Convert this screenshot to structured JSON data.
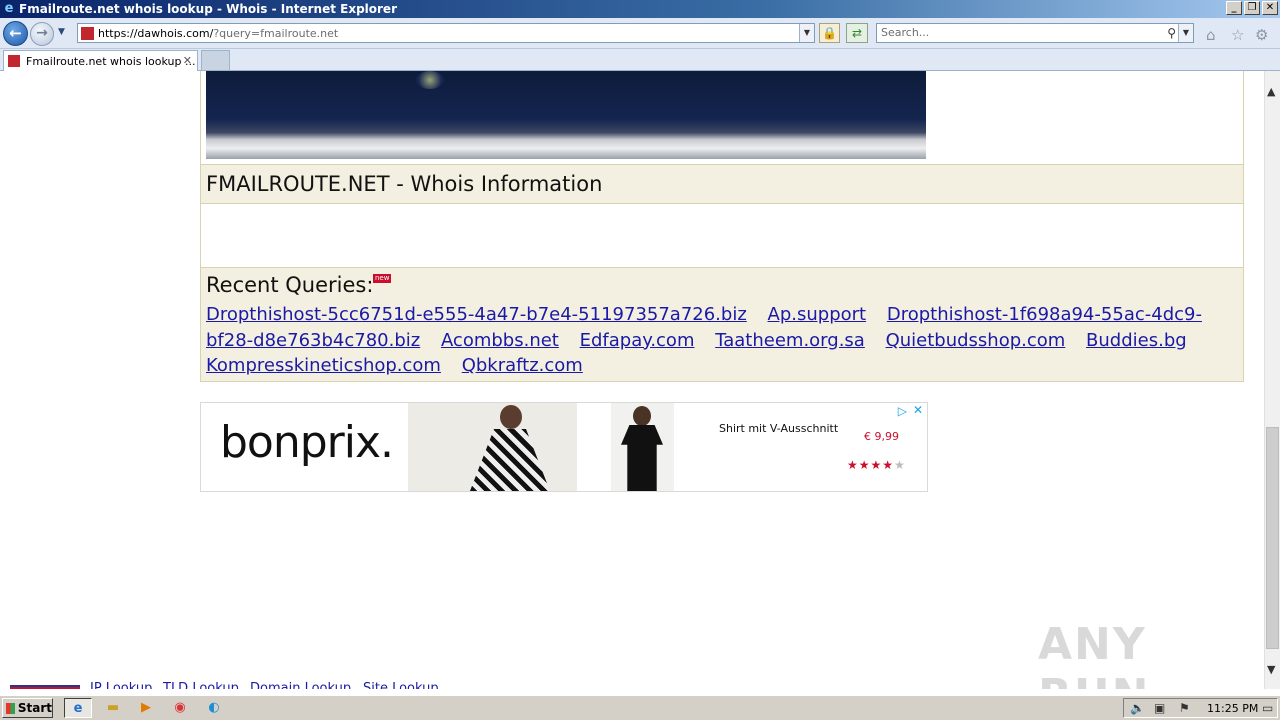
{
  "window": {
    "title": "Fmailroute.net whois lookup - Whois - Internet Explorer",
    "controls": [
      "_",
      "❐",
      "✕"
    ]
  },
  "address_bar": {
    "url_main": "https://dawhois.com/",
    "url_rest": "?query=fmailroute.net"
  },
  "search": {
    "placeholder": "Search..."
  },
  "tabs": [
    {
      "label": "Fmailroute.net whois lookup ...",
      "active": true
    }
  ],
  "page": {
    "heading": "FMAILROUTE.NET - Whois Information",
    "recent_title": "Recent Queries:",
    "new_badge": "new",
    "recent_links": [
      "Dropthishost-5cc6751d-e555-4a47-b7e4-51197357a726.biz",
      "Ap.support",
      "Dropthishost-1f698a94-55ac-4dc9-bf28-d8e763b4c780.biz",
      "Acombbs.net",
      "Edfapay.com",
      "Taatheem.org.sa",
      "Quietbudsshop.com",
      "Buddies.bg",
      "Kompresskineticshop.com",
      "Qbkraftz.com"
    ],
    "footer_links": [
      "IP Lookup",
      "TLD Lookup",
      "Domain Lookup",
      "Site Lookup"
    ]
  },
  "ad": {
    "brand": "bonprix.",
    "product_title": "Shirt mit V-Ausschnitt",
    "price": "€ 9,99",
    "rating_stars": 4,
    "rating_max": 5
  },
  "watermark": "ANY RUN",
  "taskbar": {
    "start_label": "Start",
    "clock": "11:25 PM"
  }
}
